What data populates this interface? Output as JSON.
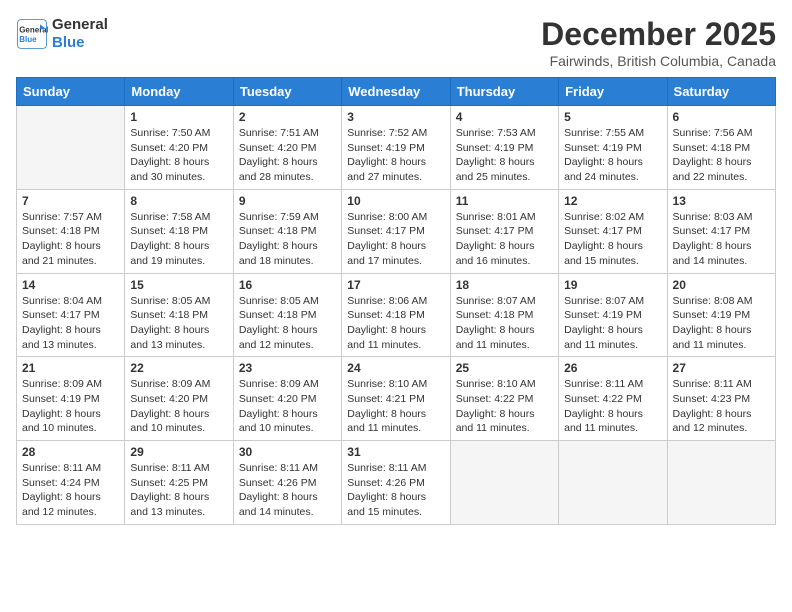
{
  "header": {
    "logo_line1": "General",
    "logo_line2": "Blue",
    "month": "December 2025",
    "location": "Fairwinds, British Columbia, Canada"
  },
  "weekdays": [
    "Sunday",
    "Monday",
    "Tuesday",
    "Wednesday",
    "Thursday",
    "Friday",
    "Saturday"
  ],
  "weeks": [
    [
      {
        "day": "",
        "sunrise": "",
        "sunset": "",
        "daylight": ""
      },
      {
        "day": "1",
        "sunrise": "7:50 AM",
        "sunset": "4:20 PM",
        "daylight": "8 hours and 30 minutes."
      },
      {
        "day": "2",
        "sunrise": "7:51 AM",
        "sunset": "4:20 PM",
        "daylight": "8 hours and 28 minutes."
      },
      {
        "day": "3",
        "sunrise": "7:52 AM",
        "sunset": "4:19 PM",
        "daylight": "8 hours and 27 minutes."
      },
      {
        "day": "4",
        "sunrise": "7:53 AM",
        "sunset": "4:19 PM",
        "daylight": "8 hours and 25 minutes."
      },
      {
        "day": "5",
        "sunrise": "7:55 AM",
        "sunset": "4:19 PM",
        "daylight": "8 hours and 24 minutes."
      },
      {
        "day": "6",
        "sunrise": "7:56 AM",
        "sunset": "4:18 PM",
        "daylight": "8 hours and 22 minutes."
      }
    ],
    [
      {
        "day": "7",
        "sunrise": "7:57 AM",
        "sunset": "4:18 PM",
        "daylight": "8 hours and 21 minutes."
      },
      {
        "day": "8",
        "sunrise": "7:58 AM",
        "sunset": "4:18 PM",
        "daylight": "8 hours and 19 minutes."
      },
      {
        "day": "9",
        "sunrise": "7:59 AM",
        "sunset": "4:18 PM",
        "daylight": "8 hours and 18 minutes."
      },
      {
        "day": "10",
        "sunrise": "8:00 AM",
        "sunset": "4:17 PM",
        "daylight": "8 hours and 17 minutes."
      },
      {
        "day": "11",
        "sunrise": "8:01 AM",
        "sunset": "4:17 PM",
        "daylight": "8 hours and 16 minutes."
      },
      {
        "day": "12",
        "sunrise": "8:02 AM",
        "sunset": "4:17 PM",
        "daylight": "8 hours and 15 minutes."
      },
      {
        "day": "13",
        "sunrise": "8:03 AM",
        "sunset": "4:17 PM",
        "daylight": "8 hours and 14 minutes."
      }
    ],
    [
      {
        "day": "14",
        "sunrise": "8:04 AM",
        "sunset": "4:17 PM",
        "daylight": "8 hours and 13 minutes."
      },
      {
        "day": "15",
        "sunrise": "8:05 AM",
        "sunset": "4:18 PM",
        "daylight": "8 hours and 13 minutes."
      },
      {
        "day": "16",
        "sunrise": "8:05 AM",
        "sunset": "4:18 PM",
        "daylight": "8 hours and 12 minutes."
      },
      {
        "day": "17",
        "sunrise": "8:06 AM",
        "sunset": "4:18 PM",
        "daylight": "8 hours and 11 minutes."
      },
      {
        "day": "18",
        "sunrise": "8:07 AM",
        "sunset": "4:18 PM",
        "daylight": "8 hours and 11 minutes."
      },
      {
        "day": "19",
        "sunrise": "8:07 AM",
        "sunset": "4:19 PM",
        "daylight": "8 hours and 11 minutes."
      },
      {
        "day": "20",
        "sunrise": "8:08 AM",
        "sunset": "4:19 PM",
        "daylight": "8 hours and 11 minutes."
      }
    ],
    [
      {
        "day": "21",
        "sunrise": "8:09 AM",
        "sunset": "4:19 PM",
        "daylight": "8 hours and 10 minutes."
      },
      {
        "day": "22",
        "sunrise": "8:09 AM",
        "sunset": "4:20 PM",
        "daylight": "8 hours and 10 minutes."
      },
      {
        "day": "23",
        "sunrise": "8:09 AM",
        "sunset": "4:20 PM",
        "daylight": "8 hours and 10 minutes."
      },
      {
        "day": "24",
        "sunrise": "8:10 AM",
        "sunset": "4:21 PM",
        "daylight": "8 hours and 11 minutes."
      },
      {
        "day": "25",
        "sunrise": "8:10 AM",
        "sunset": "4:22 PM",
        "daylight": "8 hours and 11 minutes."
      },
      {
        "day": "26",
        "sunrise": "8:11 AM",
        "sunset": "4:22 PM",
        "daylight": "8 hours and 11 minutes."
      },
      {
        "day": "27",
        "sunrise": "8:11 AM",
        "sunset": "4:23 PM",
        "daylight": "8 hours and 12 minutes."
      }
    ],
    [
      {
        "day": "28",
        "sunrise": "8:11 AM",
        "sunset": "4:24 PM",
        "daylight": "8 hours and 12 minutes."
      },
      {
        "day": "29",
        "sunrise": "8:11 AM",
        "sunset": "4:25 PM",
        "daylight": "8 hours and 13 minutes."
      },
      {
        "day": "30",
        "sunrise": "8:11 AM",
        "sunset": "4:26 PM",
        "daylight": "8 hours and 14 minutes."
      },
      {
        "day": "31",
        "sunrise": "8:11 AM",
        "sunset": "4:26 PM",
        "daylight": "8 hours and 15 minutes."
      },
      {
        "day": "",
        "sunrise": "",
        "sunset": "",
        "daylight": ""
      },
      {
        "day": "",
        "sunrise": "",
        "sunset": "",
        "daylight": ""
      },
      {
        "day": "",
        "sunrise": "",
        "sunset": "",
        "daylight": ""
      }
    ]
  ]
}
